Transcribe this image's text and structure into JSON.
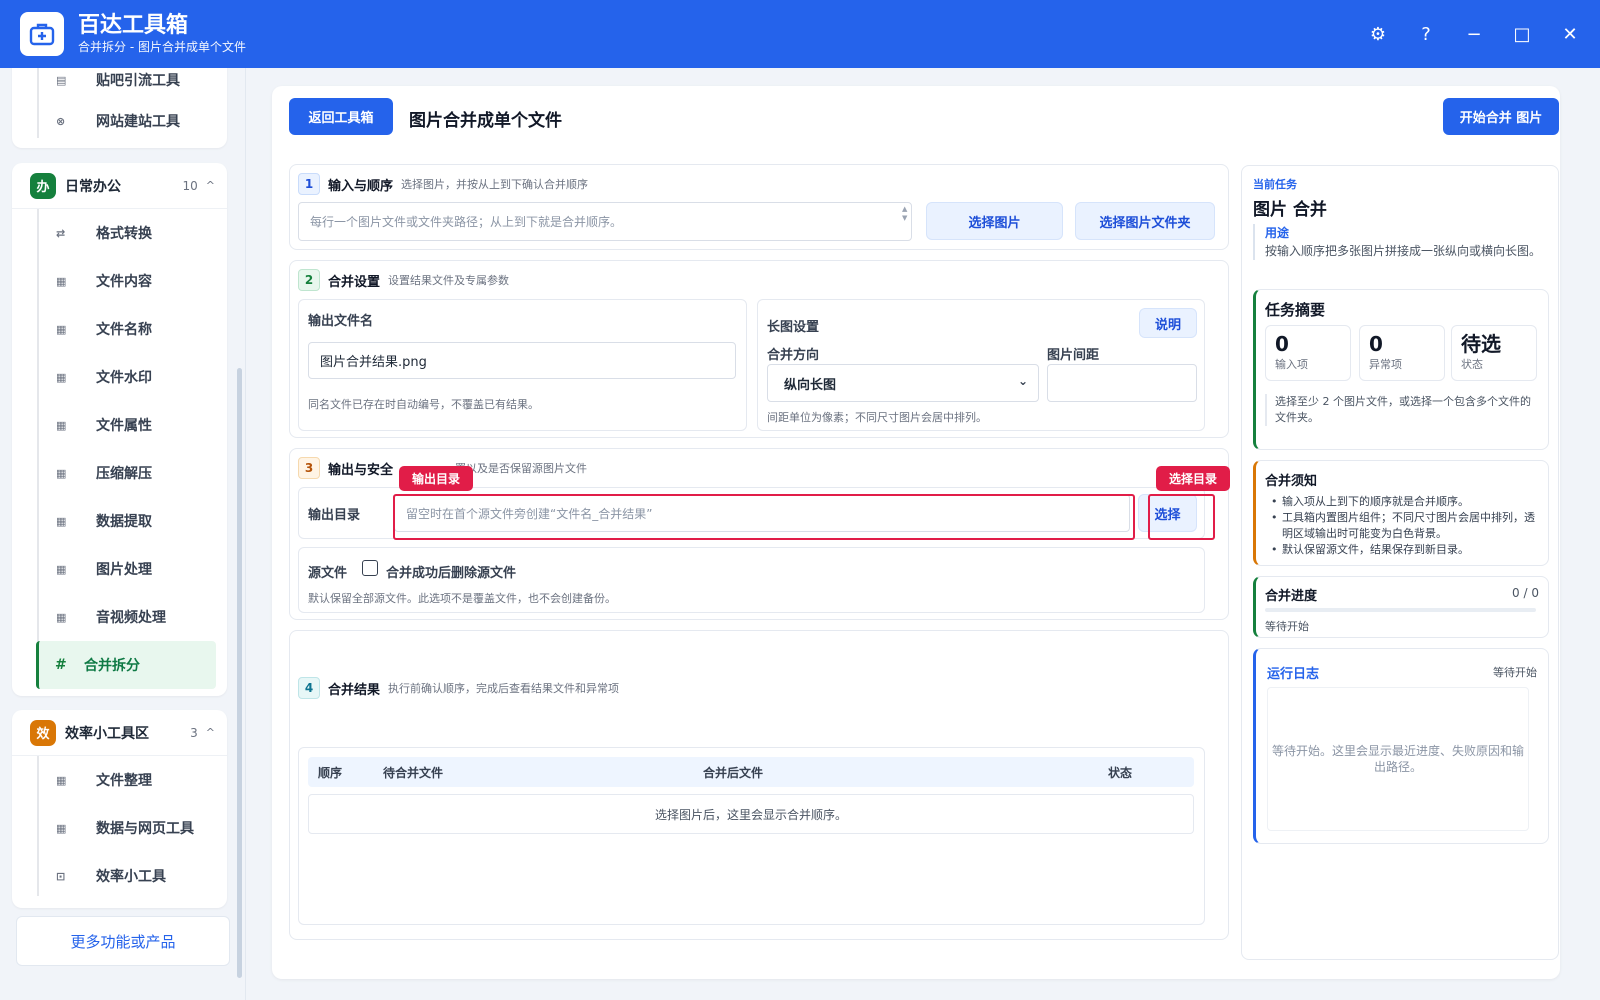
{
  "app": {
    "title": "百达工具箱",
    "subtitle": "合并拆分 - 图片合并成单个文件"
  },
  "window_controls": {
    "settings": "⚙",
    "help": "?",
    "minimize": "−",
    "maximize": "□",
    "close": "✕"
  },
  "sidebar": {
    "top_items": [
      {
        "label": "贴吧引流工具",
        "icon": "document-icon"
      },
      {
        "label": "网站建站工具",
        "icon": "globe-icon"
      }
    ],
    "groups": [
      {
        "badge": "办",
        "badge_color": "#15803d",
        "name": "日常办公",
        "count": "10",
        "caret": "^",
        "items": [
          {
            "label": "格式转换"
          },
          {
            "label": "文件内容"
          },
          {
            "label": "文件名称"
          },
          {
            "label": "文件水印"
          },
          {
            "label": "文件属性"
          },
          {
            "label": "压缩解压"
          },
          {
            "label": "数据提取"
          },
          {
            "label": "图片处理"
          },
          {
            "label": "音视频处理"
          },
          {
            "label": "合并拆分",
            "active": true
          }
        ]
      },
      {
        "badge": "效",
        "badge_color": "#d97706",
        "name": "效率小工具区",
        "count": "3",
        "caret": "^",
        "items": [
          {
            "label": "文件整理"
          },
          {
            "label": "数据与网页工具"
          },
          {
            "label": "效率小工具"
          }
        ]
      }
    ],
    "more": "更多功能或产品"
  },
  "header": {
    "back": "返回工具箱",
    "title": "图片合并成单个文件",
    "start": "开始合并 图片"
  },
  "section1": {
    "num": "1",
    "title": "输入与顺序",
    "desc": "选择图片，并按从上到下确认合并顺序",
    "input_placeholder": "每行一个图片文件或文件夹路径；从上到下就是合并顺序。",
    "btn_select_images": "选择图片",
    "btn_select_folder": "选择图片文件夹"
  },
  "section2": {
    "num": "2",
    "title": "合并设置",
    "desc": "设置结果文件及专属参数",
    "filename_label": "输出文件名",
    "filename_value": "图片合并结果.png",
    "filename_hint": "同名文件已存在时自动编号，不覆盖已有结果。",
    "long_title": "长图设置",
    "explain_btn": "说明",
    "direction_label": "合并方向",
    "direction_value": "纵向长图",
    "spacing_label": "图片间距",
    "spacing_value": "",
    "long_hint": "间距单位为像素；不同尺寸图片会居中排列。"
  },
  "section3": {
    "num": "3",
    "title": "输出与安全",
    "desc": "置以及是否保留源图片文件",
    "tag_output_dir": "输出目录",
    "tag_select_dir": "选择目录",
    "dir_label": "输出目录",
    "dir_placeholder": "留空时在首个源文件旁创建“文件名_合并结果”",
    "dir_btn": "选择",
    "src_label": "源文件",
    "delete_label": "合并成功后删除源文件",
    "src_hint": "默认保留全部源文件。此选项不是覆盖文件，也不会创建备份。"
  },
  "section4": {
    "num": "4",
    "title": "合并结果",
    "desc": "执行前确认顺序，完成后查看结果文件和异常项",
    "columns": [
      "顺序",
      "待合并文件",
      "合并后文件",
      "状态"
    ],
    "empty": "选择图片后，这里会显示合并顺序。"
  },
  "right": {
    "task_label": "当前任务",
    "task_title": "图片 合并",
    "purpose_label": "用途",
    "purpose_text": "按输入顺序把多张图片拼接成一张纵向或横向长图。",
    "summary_title": "任务摘要",
    "stats": [
      {
        "value": "0",
        "label": "输入项"
      },
      {
        "value": "0",
        "label": "异常项"
      },
      {
        "value": "待选",
        "label": "状态"
      }
    ],
    "summary_hint": "选择至少 2 个图片文件，或选择一个包含多个文件的文件夹。",
    "notice_title": "合并须知",
    "notice_items": [
      "输入项从上到下的顺序就是合并顺序。",
      "工具箱内置图片组件；不同尺寸图片会居中排列，透明区域输出时可能变为白色背景。",
      "默认保留源文件，结果保存到新目录。"
    ],
    "progress_title": "合并进度",
    "progress_count": "0 / 0",
    "progress_value": 0,
    "progress_status": "等待开始",
    "log_title": "运行日志",
    "log_status": "等待开始",
    "log_placeholder": "等待开始。这里会显示最近进度、失败原因和输出路径。"
  },
  "colors": {
    "brand": "#2563eb",
    "highlight": "#e11d48",
    "office_green": "#15803d",
    "tools_orange": "#d97706"
  }
}
